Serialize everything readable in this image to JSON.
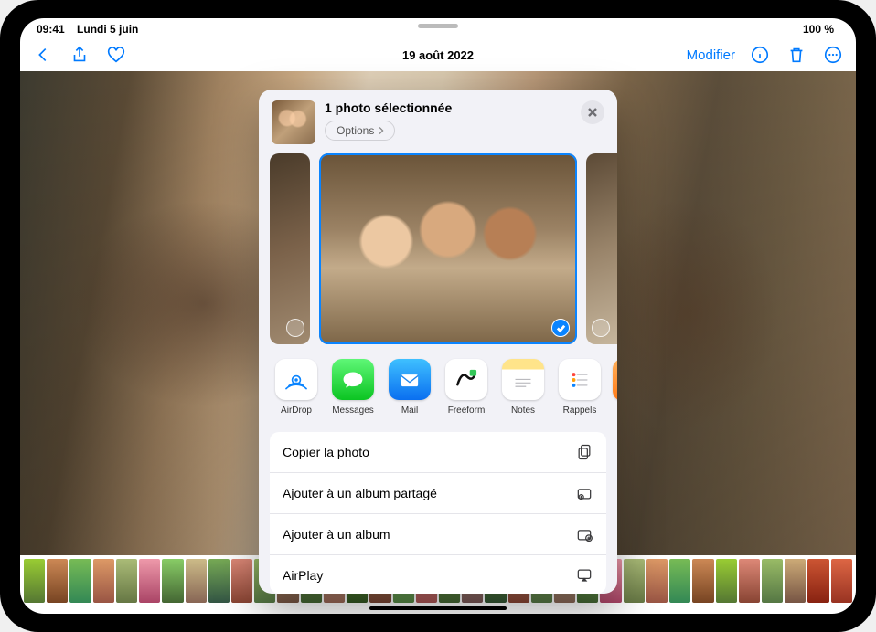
{
  "status": {
    "time": "09:41",
    "date": "Lundi 5 juin",
    "battery_text": "100 %"
  },
  "toolbar": {
    "title": "19 août 2022",
    "modify": "Modifier"
  },
  "sheet": {
    "title": "1 photo sélectionnée",
    "options_label": "Options",
    "apps": [
      {
        "key": "airdrop",
        "label": "AirDrop"
      },
      {
        "key": "messages",
        "label": "Messages"
      },
      {
        "key": "mail",
        "label": "Mail"
      },
      {
        "key": "freeform",
        "label": "Freeform"
      },
      {
        "key": "notes",
        "label": "Notes"
      },
      {
        "key": "rappels",
        "label": "Rappels"
      }
    ],
    "actions": [
      {
        "key": "copy",
        "label": "Copier la photo"
      },
      {
        "key": "shared_album",
        "label": "Ajouter à un album partagé"
      },
      {
        "key": "album",
        "label": "Ajouter à un album"
      },
      {
        "key": "airplay",
        "label": "AirPlay"
      }
    ]
  },
  "colors": {
    "accent": "#007aff",
    "sheet_bg": "#f2f2f7"
  }
}
